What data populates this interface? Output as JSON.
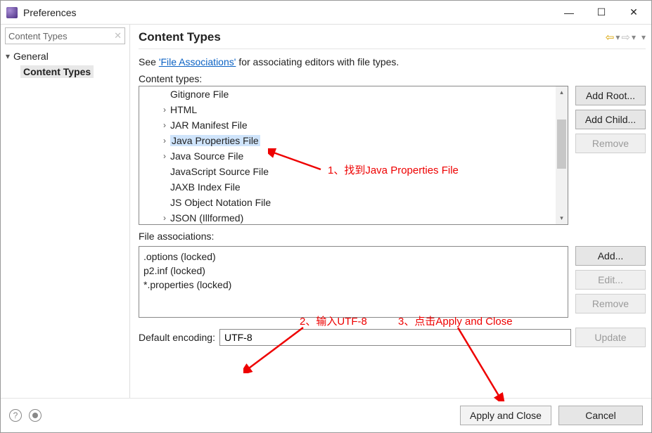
{
  "window": {
    "title": "Preferences"
  },
  "filter_placeholder": "Content Types",
  "sidebar": {
    "root": "General",
    "selected": "Content Types"
  },
  "page": {
    "heading": "Content Types",
    "description_prefix": "See ",
    "description_link": "'File Associations'",
    "description_suffix": " for associating editors with file types.",
    "content_types_label": "Content types:",
    "content_types": [
      {
        "label": "Gitignore File",
        "expandable": false
      },
      {
        "label": "HTML",
        "expandable": true
      },
      {
        "label": "JAR Manifest File",
        "expandable": true
      },
      {
        "label": "Java Properties File",
        "expandable": true,
        "selected": true
      },
      {
        "label": "Java Source File",
        "expandable": true
      },
      {
        "label": "JavaScript Source File",
        "expandable": false
      },
      {
        "label": "JAXB Index File",
        "expandable": false
      },
      {
        "label": "JS Object Notation File",
        "expandable": false
      },
      {
        "label": "JSON (Illformed)",
        "expandable": true
      }
    ],
    "buttons": {
      "add_root": "Add Root...",
      "add_child": "Add Child...",
      "remove_type": "Remove"
    },
    "file_assoc_label": "File associations:",
    "file_assoc": [
      ".options (locked)",
      "p2.inf (locked)",
      "*.properties (locked)"
    ],
    "fa_buttons": {
      "add": "Add...",
      "edit": "Edit...",
      "remove": "Remove"
    },
    "encoding_label": "Default encoding:",
    "encoding_value": "UTF-8",
    "update_btn": "Update"
  },
  "footer": {
    "apply_close": "Apply and Close",
    "cancel": "Cancel"
  },
  "annotations": {
    "a1": "1、找到Java Properties File",
    "a2": "2、输入UTF-8",
    "a3": "3、点击Apply and Close"
  }
}
